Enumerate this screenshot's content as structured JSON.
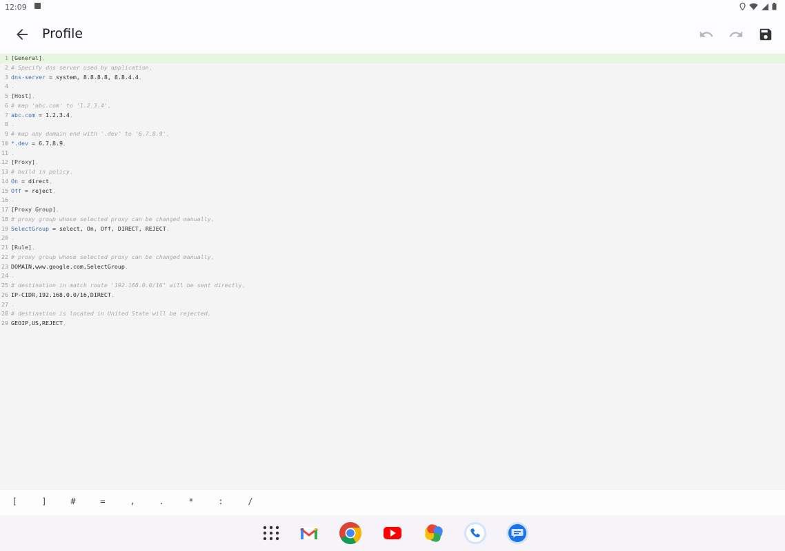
{
  "status": {
    "time": "12:09"
  },
  "appbar": {
    "title": "Profile"
  },
  "editor": {
    "lines": [
      {
        "n": "1",
        "parts": [
          [
            "sec",
            "[General]"
          ],
          [
            "dot",
            ","
          ]
        ]
      },
      {
        "n": "2",
        "parts": [
          [
            "cmt",
            "# Specify dns server used by application"
          ],
          [
            "dot",
            ","
          ]
        ]
      },
      {
        "n": "3",
        "parts": [
          [
            "key",
            "dns-server"
          ],
          [
            "code",
            " = system, 8.8.8.8, 8.8.4.4"
          ],
          [
            "dot",
            ","
          ]
        ]
      },
      {
        "n": "4",
        "parts": [
          [
            "dot",
            "."
          ]
        ]
      },
      {
        "n": "5",
        "parts": [
          [
            "sec",
            "[Host]"
          ],
          [
            "dot",
            ","
          ]
        ]
      },
      {
        "n": "6",
        "parts": [
          [
            "cmt",
            "# map 'abc.com' to '1.2.3.4'"
          ],
          [
            "dot",
            ","
          ]
        ]
      },
      {
        "n": "7",
        "parts": [
          [
            "key",
            "abc.com"
          ],
          [
            "code",
            " = 1.2.3.4"
          ],
          [
            "dot",
            ","
          ]
        ]
      },
      {
        "n": "8",
        "parts": [
          [
            "dot",
            "."
          ]
        ]
      },
      {
        "n": "9",
        "parts": [
          [
            "cmt",
            "# map any domain end with '.dev' to '6.7.8.9'"
          ],
          [
            "dot",
            ","
          ]
        ]
      },
      {
        "n": "10",
        "parts": [
          [
            "key",
            "*.dev"
          ],
          [
            "code",
            " = 6.7.8.9"
          ],
          [
            "dot",
            ","
          ]
        ]
      },
      {
        "n": "11",
        "parts": [
          [
            "dot",
            "."
          ]
        ]
      },
      {
        "n": "12",
        "parts": [
          [
            "sec",
            "[Proxy]"
          ],
          [
            "dot",
            ","
          ]
        ]
      },
      {
        "n": "13",
        "parts": [
          [
            "cmt",
            "# build in policy"
          ],
          [
            "dot",
            ","
          ]
        ]
      },
      {
        "n": "14",
        "parts": [
          [
            "key",
            "On"
          ],
          [
            "code",
            " = direct"
          ],
          [
            "dot",
            ","
          ]
        ]
      },
      {
        "n": "15",
        "parts": [
          [
            "key",
            "Off"
          ],
          [
            "code",
            " = reject"
          ],
          [
            "dot",
            ","
          ]
        ]
      },
      {
        "n": "16",
        "parts": [
          [
            "dot",
            "."
          ]
        ]
      },
      {
        "n": "17",
        "parts": [
          [
            "sec",
            "[Proxy Group]"
          ],
          [
            "dot",
            ","
          ]
        ]
      },
      {
        "n": "18",
        "parts": [
          [
            "cmt",
            "# proxy group whose selected proxy can be changed manually"
          ],
          [
            "dot",
            ","
          ]
        ]
      },
      {
        "n": "19",
        "parts": [
          [
            "key",
            "SelectGroup"
          ],
          [
            "code",
            " = select, On, Off, DIRECT, REJECT"
          ],
          [
            "dot",
            ","
          ]
        ]
      },
      {
        "n": "20",
        "parts": [
          [
            "dot",
            "."
          ]
        ]
      },
      {
        "n": "21",
        "parts": [
          [
            "sec",
            "[Rule]"
          ],
          [
            "dot",
            ","
          ]
        ]
      },
      {
        "n": "22",
        "parts": [
          [
            "cmt",
            "# proxy group whose selected proxy can be changed manually"
          ],
          [
            "dot",
            ","
          ]
        ]
      },
      {
        "n": "23",
        "parts": [
          [
            "code",
            "DOMAIN,www.google.com,SelectGroup"
          ],
          [
            "dot",
            ","
          ]
        ]
      },
      {
        "n": "24",
        "parts": [
          [
            "dot",
            "."
          ]
        ]
      },
      {
        "n": "25",
        "parts": [
          [
            "cmt",
            "# destination in match route '192.168.0.0/16' will be sent directly"
          ],
          [
            "dot",
            ","
          ]
        ]
      },
      {
        "n": "26",
        "parts": [
          [
            "code",
            "IP-CIDR,192.168.0.0/16,DIRECT"
          ],
          [
            "dot",
            ","
          ]
        ]
      },
      {
        "n": "27",
        "parts": [
          [
            "dot",
            "."
          ]
        ]
      },
      {
        "n": "28",
        "parts": [
          [
            "cmt",
            "# destination is located in United State will be rejected"
          ],
          [
            "dot",
            ","
          ]
        ]
      },
      {
        "n": "29",
        "parts": [
          [
            "code",
            "GEOIP,US,REJECT"
          ],
          [
            "dot",
            ","
          ]
        ]
      }
    ]
  },
  "symbols": [
    "[",
    "]",
    "#",
    "=",
    ",",
    ".",
    "*",
    ":",
    "/"
  ],
  "dock": [
    "app-drawer",
    "gmail",
    "chrome",
    "youtube",
    "photos",
    "phone",
    "messages"
  ],
  "colors": {
    "active_line": "#e8f5e0",
    "keyword": "#3f6fb5",
    "comment": "#a8a8a8"
  }
}
